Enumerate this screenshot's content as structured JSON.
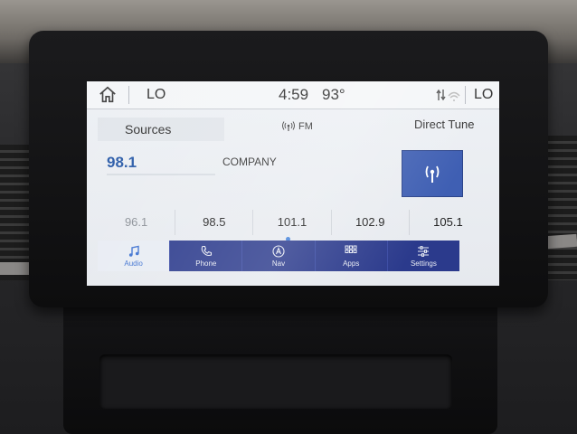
{
  "status": {
    "left_temp": "LO",
    "clock": "4:59",
    "outside_temp": "93°",
    "right_temp": "LO"
  },
  "audio": {
    "sources_label": "Sources",
    "band": "FM",
    "direct_tune_label": "Direct Tune",
    "frequency": "98.1",
    "station_name": "COMPANY",
    "presets": [
      "96.1",
      "98.5",
      "101.1",
      "102.9",
      "105.1"
    ]
  },
  "nav": {
    "items": [
      {
        "label": "Audio",
        "icon": "music-note-icon"
      },
      {
        "label": "Phone",
        "icon": "phone-icon"
      },
      {
        "label": "Nav",
        "icon": "navigation-icon"
      },
      {
        "label": "Apps",
        "icon": "apps-grid-icon"
      },
      {
        "label": "Settings",
        "icon": "settings-sliders-icon"
      }
    ]
  },
  "colors": {
    "accent_blue": "#2a5ba8",
    "nav_bar": "#2b3a8c",
    "active_tile": "#3f5fb3"
  }
}
